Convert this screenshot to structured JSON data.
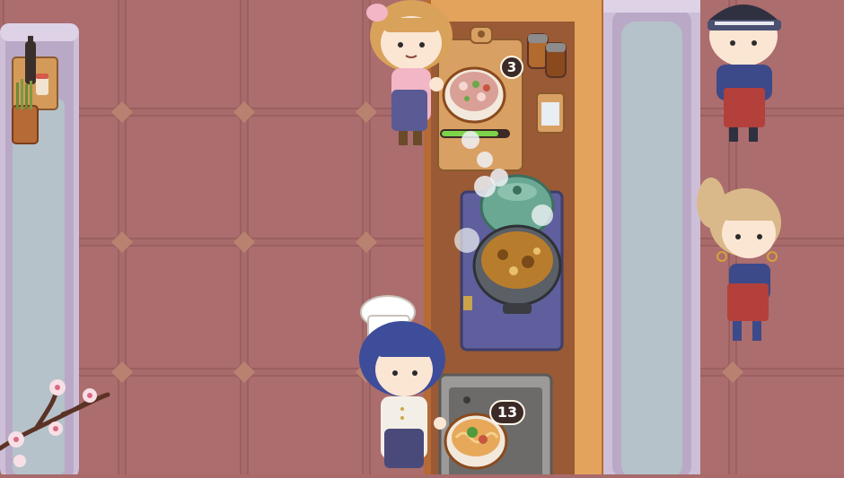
{
  "counters": {
    "prep_board_count": "3",
    "serving_bowl_count": "13"
  },
  "progress": {
    "prep_board_fraction": 0.85
  },
  "colors": {
    "floor": "#a86a6a",
    "tile_diamond": "#b98270",
    "counter_wood": "#c9854a",
    "counter_top": "#e4a35c",
    "pillar": "#cdbfd8",
    "stove": "#5e5f9c",
    "sink_gray": "#9c9a98",
    "progress_fill": "#7dd34a"
  },
  "icons": {
    "customer_top": "customer-headband-icon",
    "customer_middle": "customer-ponytail-icon",
    "waitress": "waitress-icon",
    "chef": "chef-icon",
    "pot": "soup-pot-icon",
    "kettle": "steam-kettle-icon",
    "blossom": "cherry-blossom-icon"
  }
}
